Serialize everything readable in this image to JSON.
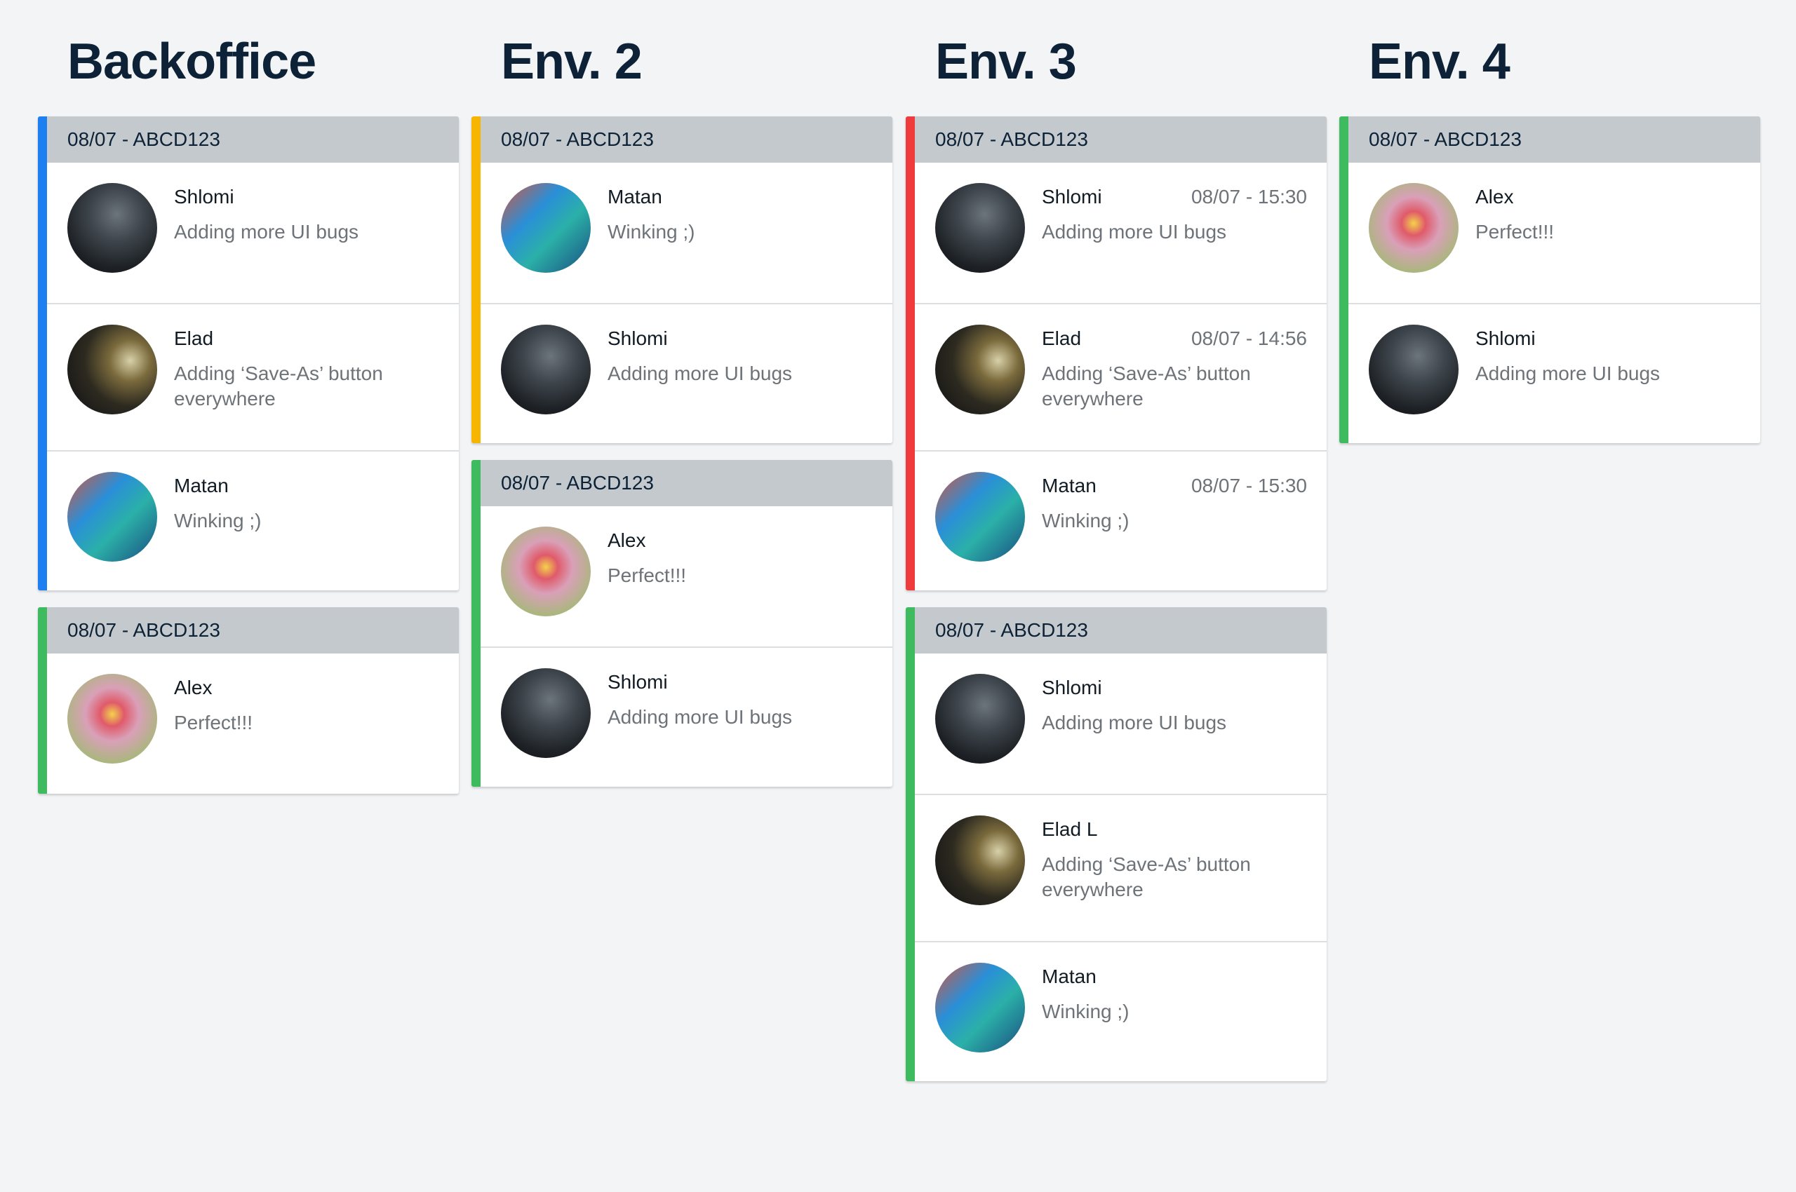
{
  "colors": {
    "blue": "#1e7ff0",
    "yellow": "#f7b500",
    "green": "#3dbb5e",
    "red": "#ef3b3b",
    "header_bg": "#c4c9cd",
    "title": "#0d2236"
  },
  "columns": [
    {
      "title": "Backoffice",
      "groups": [
        {
          "accent": "blue",
          "header": "08/07 - ABCD123",
          "items": [
            {
              "avatar": "avatar-shlomi",
              "name": "Shlomi",
              "time": "",
              "message": "Adding more UI bugs"
            },
            {
              "avatar": "avatar-elad",
              "name": "Elad",
              "time": "",
              "message": "Adding ‘Save-As’ button everywhere"
            },
            {
              "avatar": "avatar-matan",
              "name": "Matan",
              "time": "",
              "message": "Winking ;)"
            }
          ]
        },
        {
          "accent": "green",
          "header": "08/07 - ABCD123",
          "items": [
            {
              "avatar": "avatar-alex",
              "name": "Alex",
              "time": "",
              "message": "Perfect!!!"
            }
          ]
        }
      ]
    },
    {
      "title": "Env. 2",
      "groups": [
        {
          "accent": "yellow",
          "header": "08/07 - ABCD123",
          "items": [
            {
              "avatar": "avatar-matan",
              "name": "Matan",
              "time": "",
              "message": "Winking ;)"
            },
            {
              "avatar": "avatar-shlomi",
              "name": "Shlomi",
              "time": "",
              "message": "Adding more UI bugs"
            }
          ]
        },
        {
          "accent": "green",
          "header": "08/07 - ABCD123",
          "items": [
            {
              "avatar": "avatar-alex",
              "name": "Alex",
              "time": "",
              "message": "Perfect!!!"
            },
            {
              "avatar": "avatar-shlomi",
              "name": "Shlomi",
              "time": "",
              "message": "Adding more UI bugs"
            }
          ]
        }
      ]
    },
    {
      "title": "Env. 3",
      "groups": [
        {
          "accent": "red",
          "header": "08/07 - ABCD123",
          "items": [
            {
              "avatar": "avatar-shlomi",
              "name": "Shlomi",
              "time": "08/07 - 15:30",
              "message": "Adding more UI bugs"
            },
            {
              "avatar": "avatar-elad",
              "name": "Elad",
              "time": "08/07 - 14:56",
              "message": "Adding ‘Save-As’ button everywhere"
            },
            {
              "avatar": "avatar-matan",
              "name": "Matan",
              "time": "08/07 - 15:30",
              "message": "Winking ;)"
            }
          ]
        },
        {
          "accent": "green",
          "header": "08/07 - ABCD123",
          "items": [
            {
              "avatar": "avatar-shlomi",
              "name": "Shlomi",
              "time": "",
              "message": "Adding more UI bugs"
            },
            {
              "avatar": "avatar-elad",
              "name": "Elad L",
              "time": "",
              "message": "Adding ‘Save-As’ button everywhere"
            },
            {
              "avatar": "avatar-matan",
              "name": "Matan",
              "time": "",
              "message": "Winking ;)"
            }
          ]
        }
      ]
    },
    {
      "title": "Env. 4",
      "groups": [
        {
          "accent": "green",
          "header": "08/07 - ABCD123",
          "items": [
            {
              "avatar": "avatar-alex",
              "name": "Alex",
              "time": "",
              "message": "Perfect!!!"
            },
            {
              "avatar": "avatar-shlomi",
              "name": "Shlomi",
              "time": "",
              "message": "Adding more UI bugs"
            }
          ]
        }
      ]
    }
  ]
}
